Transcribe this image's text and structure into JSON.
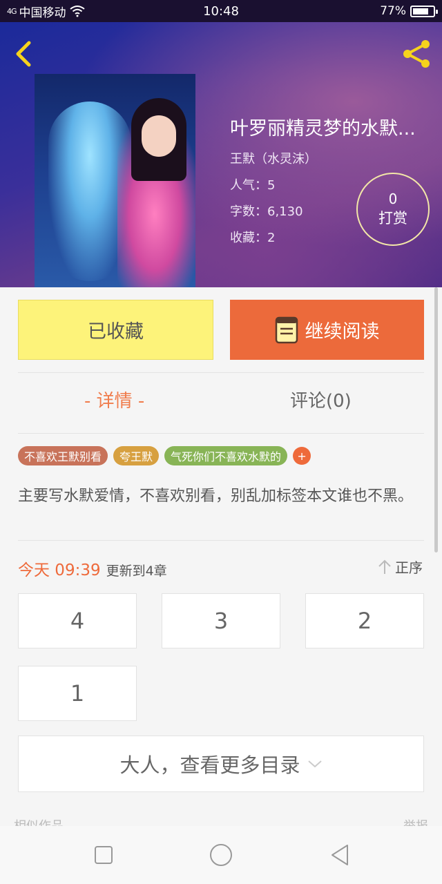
{
  "status_bar": {
    "signal": "4G",
    "carrier": "中国移动",
    "time": "10:48",
    "battery_percent": "77%",
    "battery_level": 0.77
  },
  "header": {
    "back_icon": "chevron-left-icon",
    "share_icon": "share-icon",
    "book": {
      "title": "叶罗丽精灵梦的水默...",
      "author": "王默（水灵沫）",
      "popularity": "人气：5",
      "word_count": "字数：6,130",
      "favorites": "收藏：2"
    },
    "reward": {
      "count": "0",
      "label": "打赏"
    }
  },
  "actions": {
    "collected_label": "已收藏",
    "continue_label": "继续阅读",
    "continue_icon": "book-icon"
  },
  "tabs": {
    "details": "- 详情 -",
    "comments": "评论(0)"
  },
  "tags": [
    {
      "label": "不喜欢王默别看",
      "color": "#c8735a"
    },
    {
      "label": "夸王默",
      "color": "#d7a040"
    },
    {
      "label": "气死你们不喜欢水默的",
      "color": "#88b456"
    }
  ],
  "tag_add": "+",
  "description": "主要写水默爱情，不喜欢别看，别乱加标签本文谁也不黑。",
  "update": {
    "time": "今天 09:39",
    "text": "更新到4章",
    "order_label": "正序",
    "order_icon": "arrow-up-icon"
  },
  "chapters": [
    "4",
    "3",
    "2",
    "1"
  ],
  "more_catalog": "大人，查看更多目录",
  "section_partial": {
    "left": "相似作品",
    "right": "举报"
  },
  "colors": {
    "accent": "#ec6a3b",
    "collected_bg": "#fdf37a"
  },
  "nav": {
    "recent_icon": "square-icon",
    "home_icon": "circle-icon",
    "back_icon": "triangle-back-icon"
  }
}
